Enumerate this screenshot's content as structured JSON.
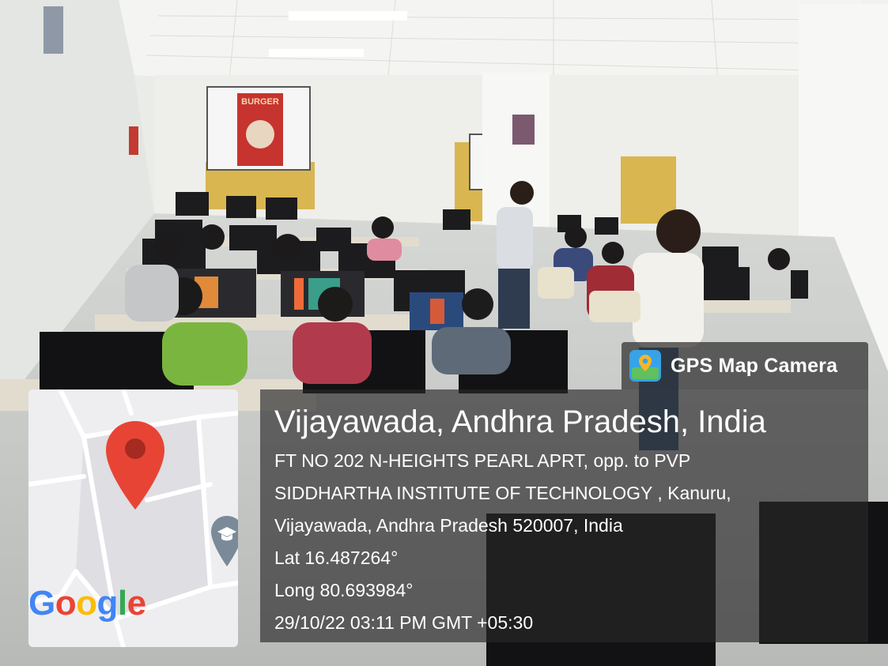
{
  "gps_tag": {
    "title": "GPS Map Camera",
    "icon": "map-camera-icon"
  },
  "location": {
    "title": "Vijayawada, Andhra Pradesh, India",
    "address_lines": [
      "FT NO 202 N-HEIGHTS PEARL APRT, opp. to PVP",
      "SIDDHARTHA INSTITUTE OF TECHNOLOGY , Kanuru,",
      "Vijayawada, Andhra Pradesh 520007, India"
    ],
    "lat": "Lat 16.487264°",
    "long": "Long 80.693984°",
    "datetime": "29/10/22 03:11 PM GMT +05:30"
  },
  "map": {
    "brand_letters": [
      "G",
      "o",
      "o",
      "g",
      "l",
      "e"
    ],
    "brand_colors": [
      "#4285F4",
      "#EA4335",
      "#FBBC05",
      "#4285F4",
      "#34A853",
      "#EA4335"
    ],
    "pin_color": "#E84435",
    "poi_icon": "education-icon"
  },
  "projector": {
    "text": "BURGER"
  },
  "colors": {
    "overlay": "#282828",
    "text": "#ffffff"
  }
}
